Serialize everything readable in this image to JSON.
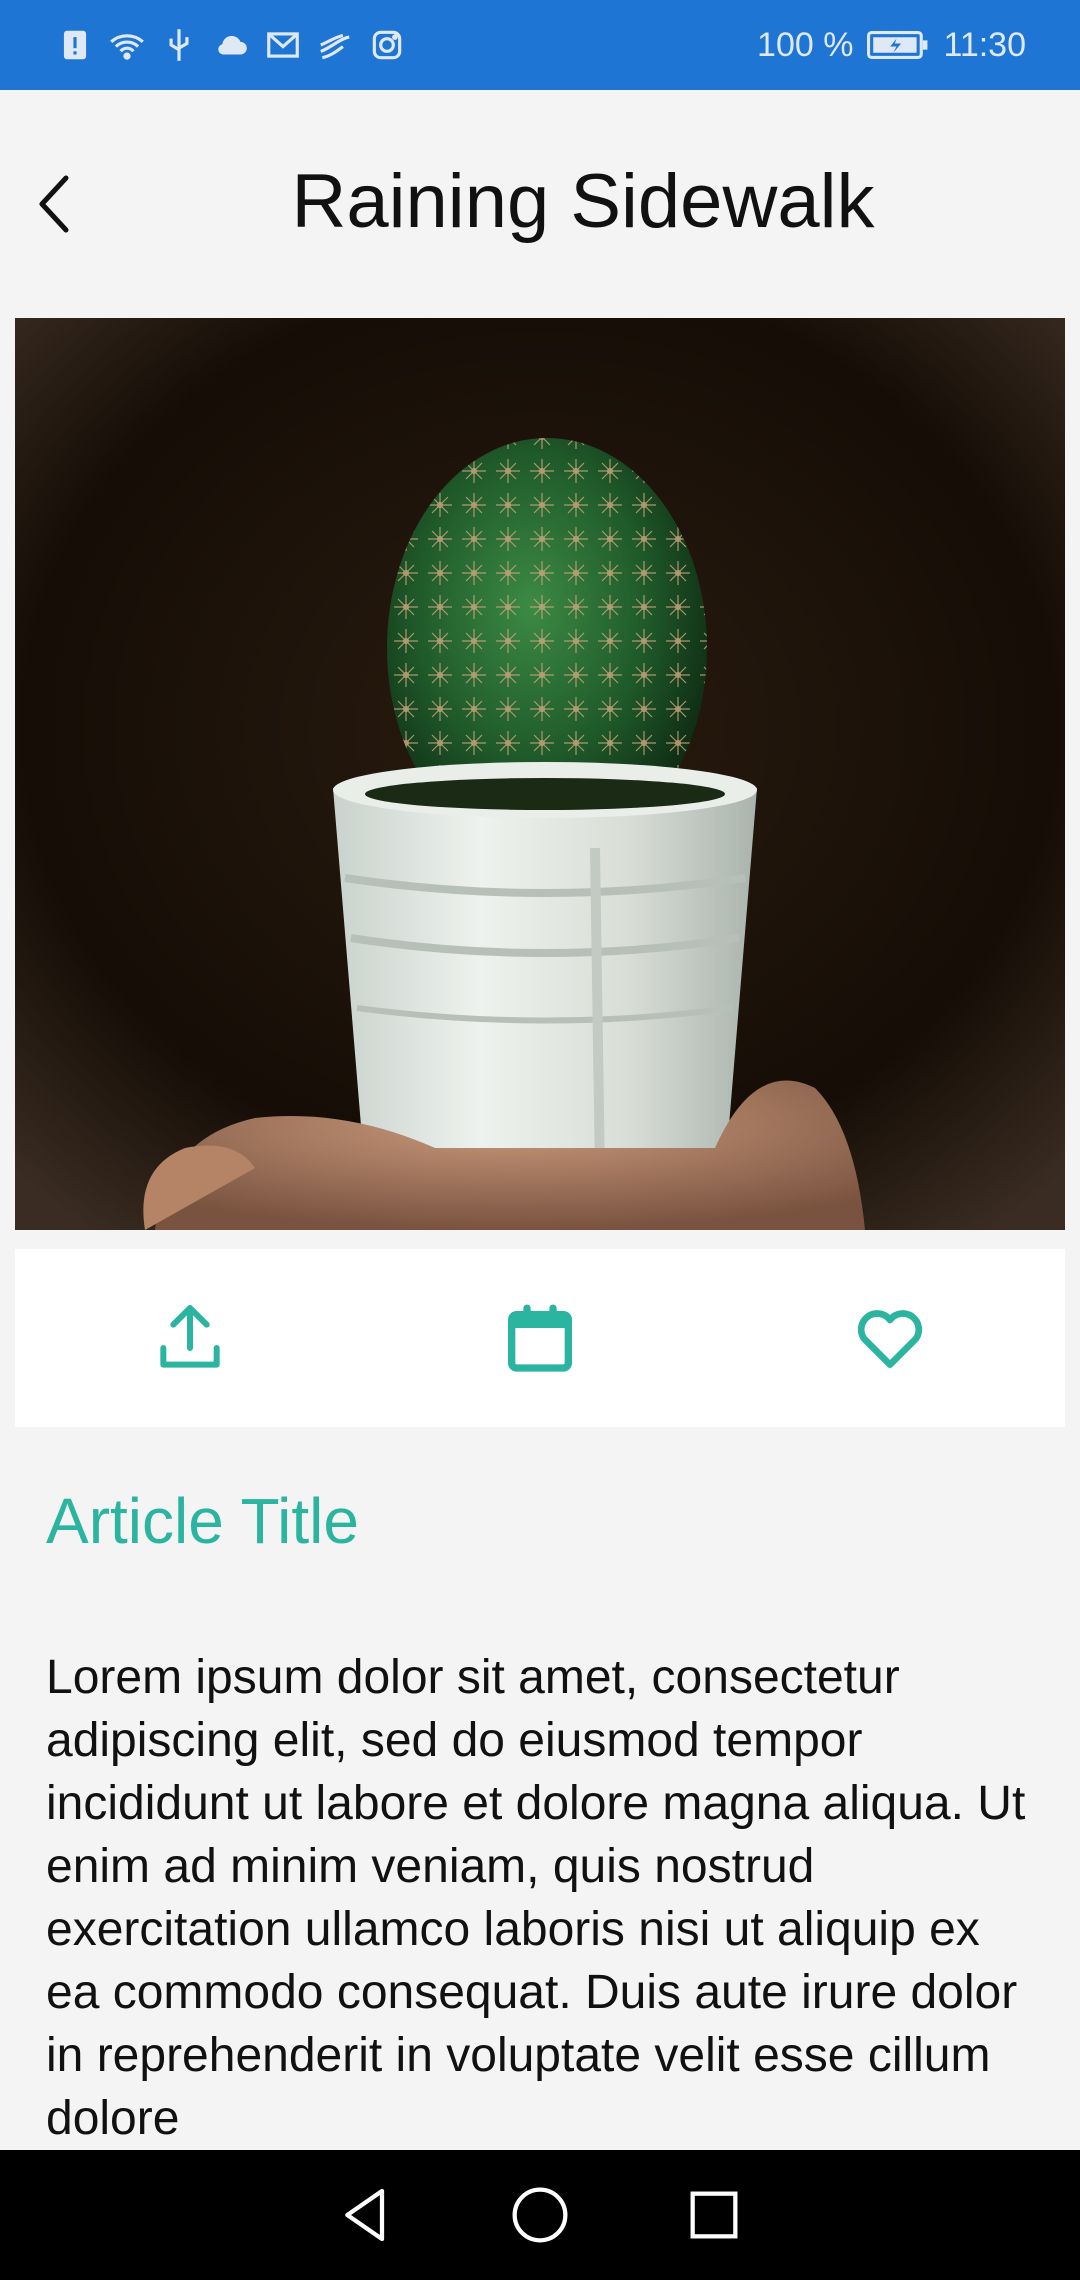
{
  "status_bar": {
    "battery_percent": "100 %",
    "time": "11:30",
    "icons": [
      "alert-icon",
      "wifi-icon",
      "usb-icon",
      "cloud-icon",
      "mail-icon",
      "cast-icon",
      "instagram-icon",
      "battery-icon"
    ]
  },
  "header": {
    "title": "Raining Sidewalk",
    "back_icon": "chevron-left-icon"
  },
  "hero": {
    "image": "cactus-in-white-pot-photo"
  },
  "actions": [
    {
      "icon": "upload-icon"
    },
    {
      "icon": "calendar-icon"
    },
    {
      "icon": "heart-icon"
    }
  ],
  "article": {
    "title": "Article Title",
    "body": "Lorem ipsum dolor sit amet, consectetur adipiscing elit, sed do eiusmod tempor incididunt ut labore et dolore magna aliqua. Ut enim ad minim veniam, quis nostrud exercitation ullamco laboris nisi ut aliquip ex ea commodo consequat. Duis aute irure dolor in reprehenderit in voluptate velit esse cillum dolore"
  },
  "nav_bar": {
    "icons": [
      "back-triangle-icon",
      "home-circle-icon",
      "recents-square-icon"
    ]
  },
  "colors": {
    "status_bar": "#1e75d3",
    "accent": "#2bb5a0",
    "background": "#f4f4f4"
  }
}
